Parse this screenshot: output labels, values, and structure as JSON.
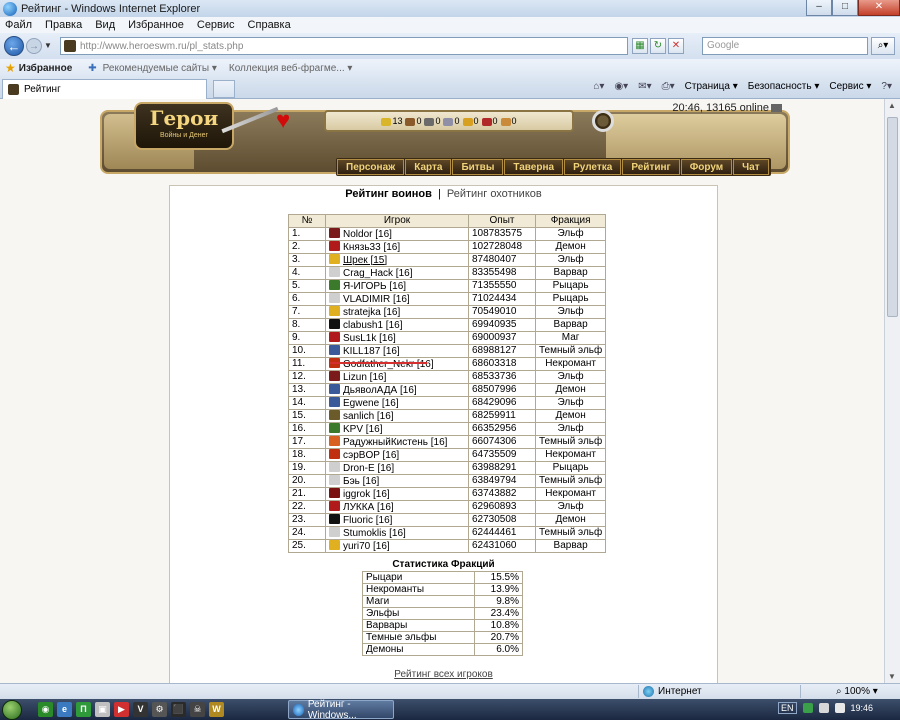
{
  "window": {
    "title": "Рейтинг - Windows Internet Explorer"
  },
  "menu": [
    "Файл",
    "Правка",
    "Вид",
    "Избранное",
    "Сервис",
    "Справка"
  ],
  "address": {
    "url": "http://www.heroeswm.ru/pl_stats.php",
    "search_placeholder": "Google"
  },
  "favorites": {
    "title": "Избранное",
    "items": [
      "Рекомендуемые сайты ▾",
      "Коллекция веб-фрагме... ▾"
    ]
  },
  "tab": {
    "title": "Рейтинг"
  },
  "commands": [
    "Страница ▾",
    "Безопасность ▾",
    "Сервис ▾"
  ],
  "game": {
    "logo_main": "Герои",
    "logo_sub": "Войны и Денег",
    "online": "20:46, 13165 online",
    "resources": [
      {
        "icon": "gold-icon",
        "value": "13",
        "color": "#d9b52a"
      },
      {
        "icon": "wood-icon",
        "value": "0",
        "color": "#8a5a2b"
      },
      {
        "icon": "ore-icon",
        "value": "0",
        "color": "#6b6b6b"
      },
      {
        "icon": "mercury-icon",
        "value": "0",
        "color": "#8f8fa8"
      },
      {
        "icon": "sulfur-icon",
        "value": "0",
        "color": "#d8a020"
      },
      {
        "icon": "crystal-icon",
        "value": "0",
        "color": "#b02828"
      },
      {
        "icon": "gems-icon",
        "value": "0",
        "color": "#c98a3a"
      }
    ],
    "nav": [
      "Персонаж",
      "Карта",
      "Битвы",
      "Таверна",
      "Рулетка",
      "Рейтинг",
      "Форум",
      "Чат"
    ]
  },
  "rating_links": {
    "active": "Рейтинг воинов",
    "separator": "|",
    "other": "Рейтинг охотников"
  },
  "table": {
    "headers": [
      "№",
      "Игрок",
      "Опыт",
      "Фракция"
    ],
    "rows": [
      {
        "num": "1.",
        "player": "Noldor [16]",
        "exp": "108783575",
        "faction": "Эльф",
        "icon": "#7a1a1a"
      },
      {
        "num": "2.",
        "player": "Князь33 [16]",
        "exp": "102728048",
        "faction": "Демон",
        "icon": "#b01a1a"
      },
      {
        "num": "3.",
        "player": "Шрек [15]",
        "exp": "87480407",
        "faction": "Эльф",
        "icon": "#e0b020"
      },
      {
        "num": "4.",
        "player": "Crag_Hack [16]",
        "exp": "83355498",
        "faction": "Варвар",
        "icon": "#cfcfcf"
      },
      {
        "num": "5.",
        "player": "Я-ИГОРЬ [16]",
        "exp": "71355550",
        "faction": "Рыцарь",
        "icon": "#3a7a2a"
      },
      {
        "num": "6.",
        "player": "VLADIMIR [16]",
        "exp": "71024434",
        "faction": "Рыцарь",
        "icon": "#cfcfcf"
      },
      {
        "num": "7.",
        "player": "stratejka [16]",
        "exp": "70549010",
        "faction": "Эльф",
        "icon": "#e0b020"
      },
      {
        "num": "8.",
        "player": "clabush1 [16]",
        "exp": "69940935",
        "faction": "Варвар",
        "icon": "#111111"
      },
      {
        "num": "9.",
        "player": "SusL1k [16]",
        "exp": "69000937",
        "faction": "Маг",
        "icon": "#b01a1a"
      },
      {
        "num": "10.",
        "player": "KILL187 [16]",
        "exp": "68988127",
        "faction": "Темный эльф",
        "icon": "#3a5a9a"
      },
      {
        "num": "11.",
        "player": "Godfather_Nekr [16]",
        "exp": "68603318",
        "faction": "Некромант",
        "icon": "#c03010"
      },
      {
        "num": "12.",
        "player": "Lizun [16]",
        "exp": "68533736",
        "faction": "Эльф",
        "icon": "#7a1a1a"
      },
      {
        "num": "13.",
        "player": "ДьяволАДА [16]",
        "exp": "68507996",
        "faction": "Демон",
        "icon": "#3a5a9a"
      },
      {
        "num": "14.",
        "player": "Egwene [16]",
        "exp": "68429096",
        "faction": "Эльф",
        "icon": "#3a5a9a"
      },
      {
        "num": "15.",
        "player": "sanlich [16]",
        "exp": "68259911",
        "faction": "Демон",
        "icon": "#6b5a2a"
      },
      {
        "num": "16.",
        "player": "KPV [16]",
        "exp": "66352956",
        "faction": "Эльф",
        "icon": "#3a7a2a"
      },
      {
        "num": "17.",
        "player": "РадужныйКистень [16]",
        "exp": "66074306",
        "faction": "Темный эльф",
        "icon": "#d86020"
      },
      {
        "num": "18.",
        "player": "сэрBOP [16]",
        "exp": "64735509",
        "faction": "Некромант",
        "icon": "#c03010"
      },
      {
        "num": "19.",
        "player": "Dron-E [16]",
        "exp": "63988291",
        "faction": "Рыцарь",
        "icon": "#cfcfcf"
      },
      {
        "num": "20.",
        "player": "Бэь [16]",
        "exp": "63849794",
        "faction": "Темный эльф",
        "icon": "#cfcfcf"
      },
      {
        "num": "21.",
        "player": "iggrok [16]",
        "exp": "63743882",
        "faction": "Некромант",
        "icon": "#7a1010"
      },
      {
        "num": "22.",
        "player": "ЛУККА [16]",
        "exp": "62960893",
        "faction": "Эльф",
        "icon": "#b01a1a"
      },
      {
        "num": "23.",
        "player": "Fluoric [16]",
        "exp": "62730508",
        "faction": "Демон",
        "icon": "#111111"
      },
      {
        "num": "24.",
        "player": "Stumoklis [16]",
        "exp": "62444461",
        "faction": "Темный эльф",
        "icon": "#cfcfcf"
      },
      {
        "num": "25.",
        "player": "yuri70 [16]",
        "exp": "62431060",
        "faction": "Варвар",
        "icon": "#e0b020"
      }
    ]
  },
  "stats": {
    "title": "Статистика Фракций",
    "rows": [
      {
        "name": "Рыцари",
        "pct": "15.5%"
      },
      {
        "name": "Некроманты",
        "pct": "13.9%"
      },
      {
        "name": "Маги",
        "pct": "9.8%"
      },
      {
        "name": "Эльфы",
        "pct": "23.4%"
      },
      {
        "name": "Варвары",
        "pct": "10.8%"
      },
      {
        "name": "Темные эльфы",
        "pct": "20.7%"
      },
      {
        "name": "Демоны",
        "pct": "6.0%"
      }
    ]
  },
  "all_players_link": "Рейтинг всех игроков",
  "status": {
    "zone": "Интернет",
    "zoom": "100%"
  },
  "taskbar": {
    "ie_task": "Рейтинг - Windows...",
    "lang": "EN",
    "clock": "19:46"
  }
}
